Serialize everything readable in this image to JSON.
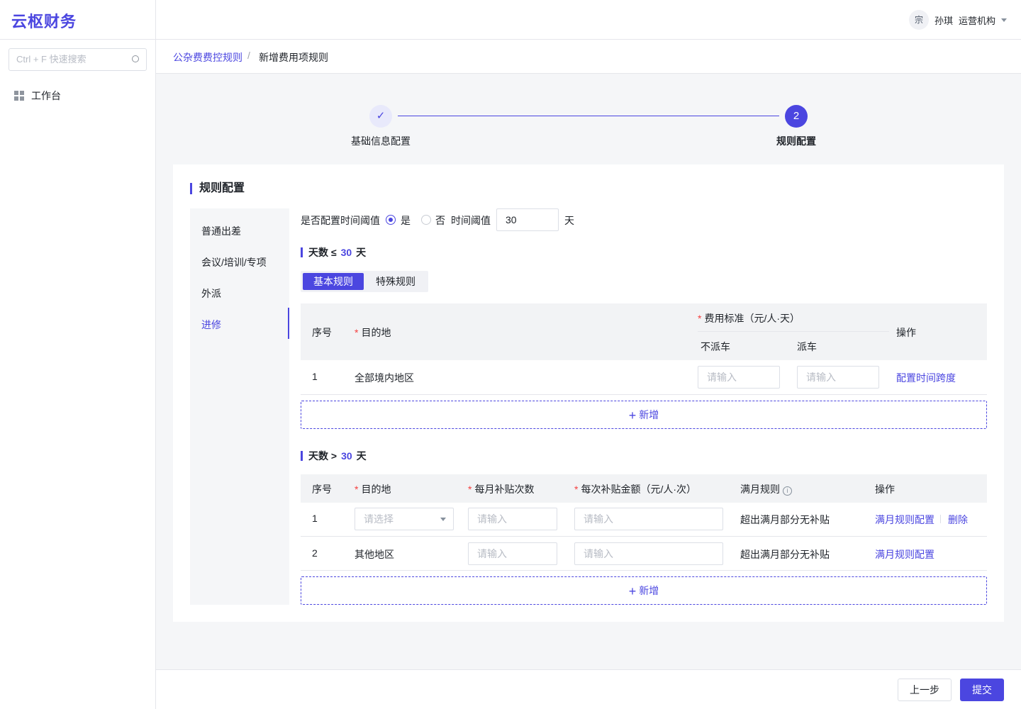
{
  "app": {
    "logo": "云枢财务"
  },
  "sidebar": {
    "search_placeholder": "Ctrl + F 快速搜索",
    "items": [
      {
        "label": "工作台",
        "icon": "grid-icon"
      }
    ]
  },
  "header": {
    "avatar": "宗",
    "user_name": "孙琪",
    "org": "运营机构"
  },
  "breadcrumb": {
    "parent": "公杂费费控规则",
    "separator": "/",
    "current": "新增费用项规则"
  },
  "steps": [
    {
      "label": "基础信息配置",
      "mark": "✓",
      "state": "done"
    },
    {
      "label": "规则配置",
      "mark": "2",
      "state": "active"
    }
  ],
  "section": {
    "title": "规则配置"
  },
  "left_nav": {
    "items": [
      "普通出差",
      "会议/培训/专项",
      "外派",
      "进修"
    ],
    "active_index": 3
  },
  "threshold": {
    "question": "是否配置时间阈值",
    "yes": "是",
    "no": "否",
    "selected": "是",
    "label": "时间阈值",
    "value": "30",
    "unit": "天"
  },
  "block1": {
    "title_prefix": "天数 ≤",
    "days": "30",
    "title_suffix": "天",
    "tabs": [
      "基本规则",
      "特殊规则"
    ],
    "active_tab": "基本规则",
    "headers": {
      "index": "序号",
      "destination": "目的地",
      "standard": "费用标准（元/人·天）",
      "no_car": "不派车",
      "car": "派车",
      "action": "操作"
    },
    "rows": [
      {
        "index": "1",
        "destination": "全部境内地区",
        "no_car_placeholder": "请输入",
        "car_placeholder": "请输入",
        "action": "配置时间跨度"
      }
    ],
    "add_label": "新增"
  },
  "block2": {
    "title_prefix": "天数 >",
    "days": "30",
    "title_suffix": "天",
    "headers": {
      "index": "序号",
      "destination": "目的地",
      "monthly_count": "每月补贴次数",
      "per_amount": "每次补贴金额（元/人·次）",
      "full_month": "满月规则",
      "action": "操作"
    },
    "rows": [
      {
        "index": "1",
        "destination_placeholder": "请选择",
        "count_placeholder": "请输入",
        "amount_placeholder": "请输入",
        "rule": "超出满月部分无补贴",
        "action1": "满月规则配置",
        "action2": "删除"
      },
      {
        "index": "2",
        "destination": "其他地区",
        "count_placeholder": "请输入",
        "amount_placeholder": "请输入",
        "rule": "超出满月部分无补贴",
        "action1": "满月规则配置"
      }
    ],
    "add_label": "新增"
  },
  "footer": {
    "prev": "上一步",
    "submit": "提交"
  },
  "colors": {
    "primary": "#4b46e0",
    "required": "#f53f3f",
    "bg": "#f5f6f8"
  }
}
